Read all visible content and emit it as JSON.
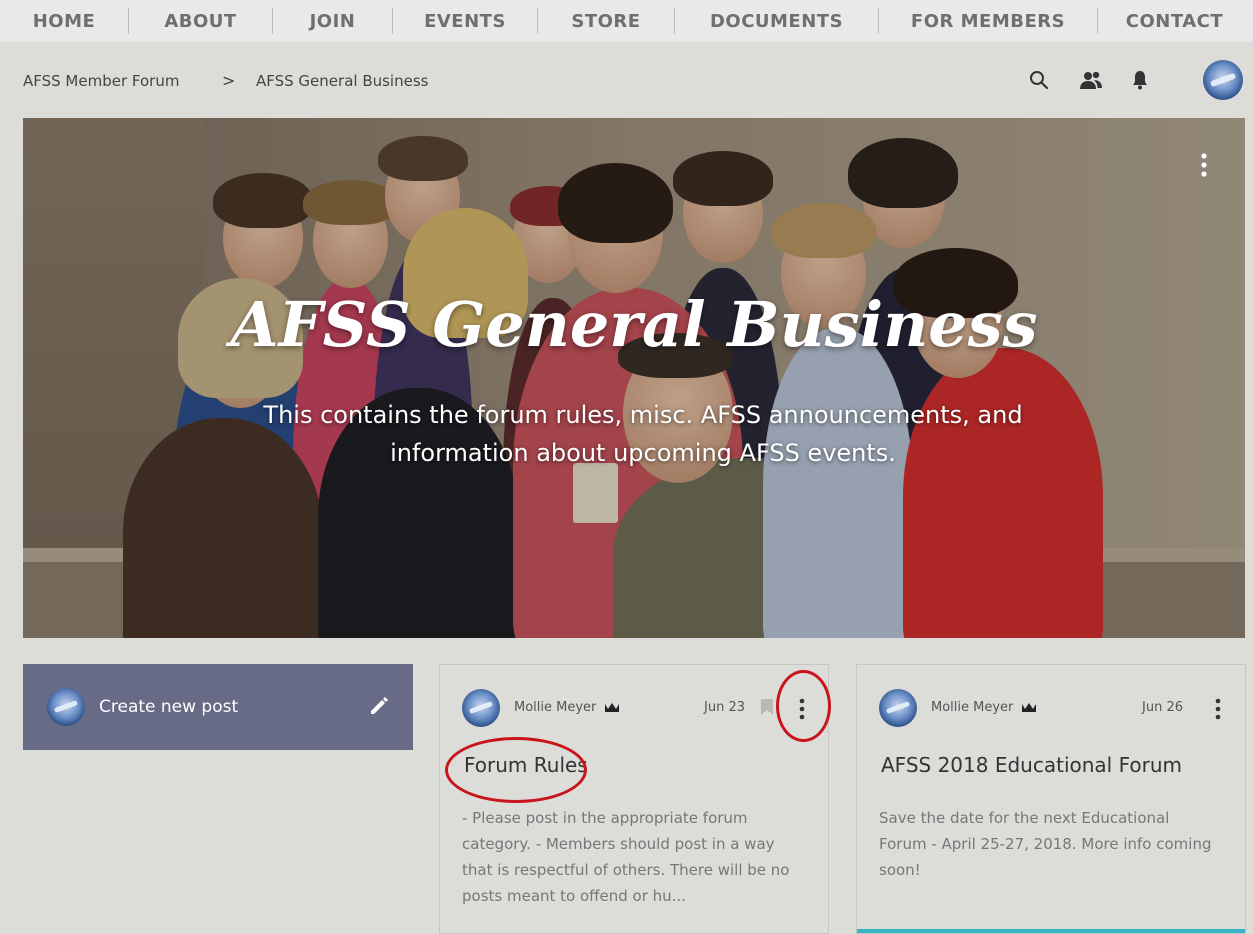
{
  "nav": {
    "items": [
      "HOME",
      "ABOUT",
      "JOIN",
      "EVENTS",
      "STORE",
      "DOCUMENTS",
      "FOR MEMBERS",
      "CONTACT"
    ]
  },
  "breadcrumb": {
    "root": "AFSS Member Forum",
    "separator": ">",
    "current": "AFSS General Business"
  },
  "header_icons": [
    "search-icon",
    "members-icon",
    "bell-icon",
    "avatar"
  ],
  "hero": {
    "title": "AFSS General Business",
    "description_line1": "This contains the forum rules, misc. AFSS announcements, and",
    "description_line2": "information about upcoming AFSS events."
  },
  "create_post": {
    "label": "Create new post"
  },
  "posts": [
    {
      "author": "Mollie Meyer",
      "date": "Jun 23",
      "title": "Forum Rules",
      "excerpt": "- Please post in the appropriate forum category. - Members should post in a way that is respectful of others. There will be no posts meant to offend or hu..."
    },
    {
      "author": "Mollie Meyer",
      "date": "Jun 26",
      "title": "AFSS 2018 Educational Forum",
      "excerpt": "Save the date for the next Educational Forum - April 25-27, 2018. More info coming soon!"
    }
  ],
  "colors": {
    "background": "#dcdcd9",
    "create_post_bg": "#686b86",
    "annotation_red": "#c8141b",
    "accent_teal": "#39b3c6"
  }
}
